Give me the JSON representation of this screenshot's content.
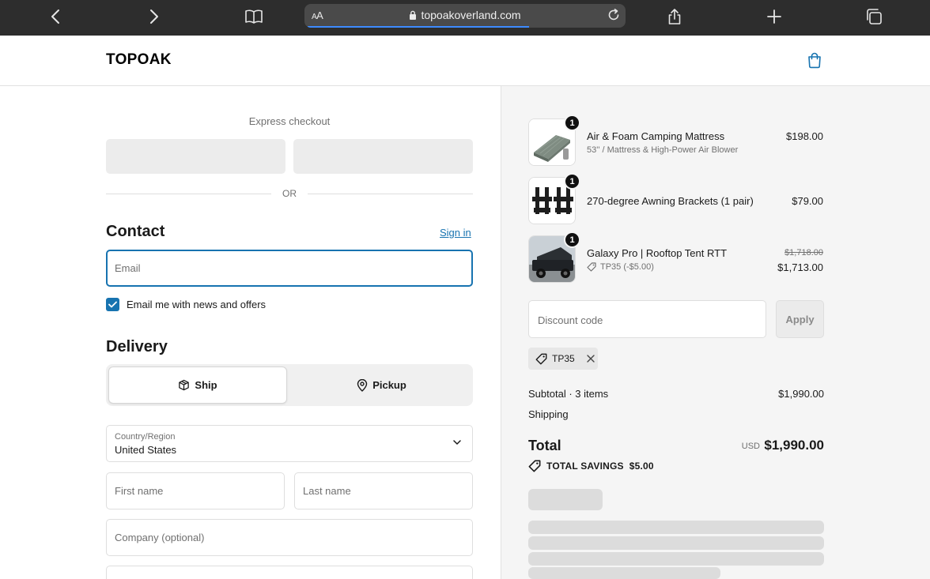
{
  "browser": {
    "url": "topoakoverland.com",
    "aa_label": "AA"
  },
  "header": {
    "brand": "TOPOAK"
  },
  "checkout": {
    "express_label": "Express checkout",
    "or_label": "OR",
    "contact_title": "Contact",
    "sign_in_label": "Sign in",
    "email_placeholder": "Email",
    "news_opt_in_label": "Email me with news and offers",
    "news_opt_in_checked": true,
    "delivery_title": "Delivery",
    "delivery_options": [
      {
        "label": "Ship",
        "selected": true
      },
      {
        "label": "Pickup",
        "selected": false
      }
    ],
    "country_label": "Country/Region",
    "country_value": "United States",
    "first_name_placeholder": "First name",
    "last_name_placeholder": "Last name",
    "company_placeholder": "Company (optional)"
  },
  "summary": {
    "items": [
      {
        "qty": "1",
        "name": "Air & Foam Camping Mattress",
        "variant": "53'' / Mattress & High-Power Air Blower",
        "price": "$198.00"
      },
      {
        "qty": "1",
        "name": "270-degree Awning Brackets (1 pair)",
        "price": "$79.00"
      },
      {
        "qty": "1",
        "name": "Galaxy Pro | Rooftop Tent RTT",
        "discount": "TP35 (-$5.00)",
        "original_price": "$1,718.00",
        "price": "$1,713.00"
      }
    ],
    "discount_placeholder": "Discount code",
    "apply_label": "Apply",
    "applied_code": "TP35",
    "subtotal_label": "Subtotal · 3 items",
    "subtotal_value": "$1,990.00",
    "shipping_label": "Shipping",
    "total_label": "Total",
    "currency": "USD",
    "total_value": "$1,990.00",
    "savings_label": "TOTAL SAVINGS",
    "savings_value": "$5.00"
  },
  "colors": {
    "accent": "#1773b0",
    "chrome": "#2d2d2d",
    "summary_bg": "#f5f5f5"
  }
}
